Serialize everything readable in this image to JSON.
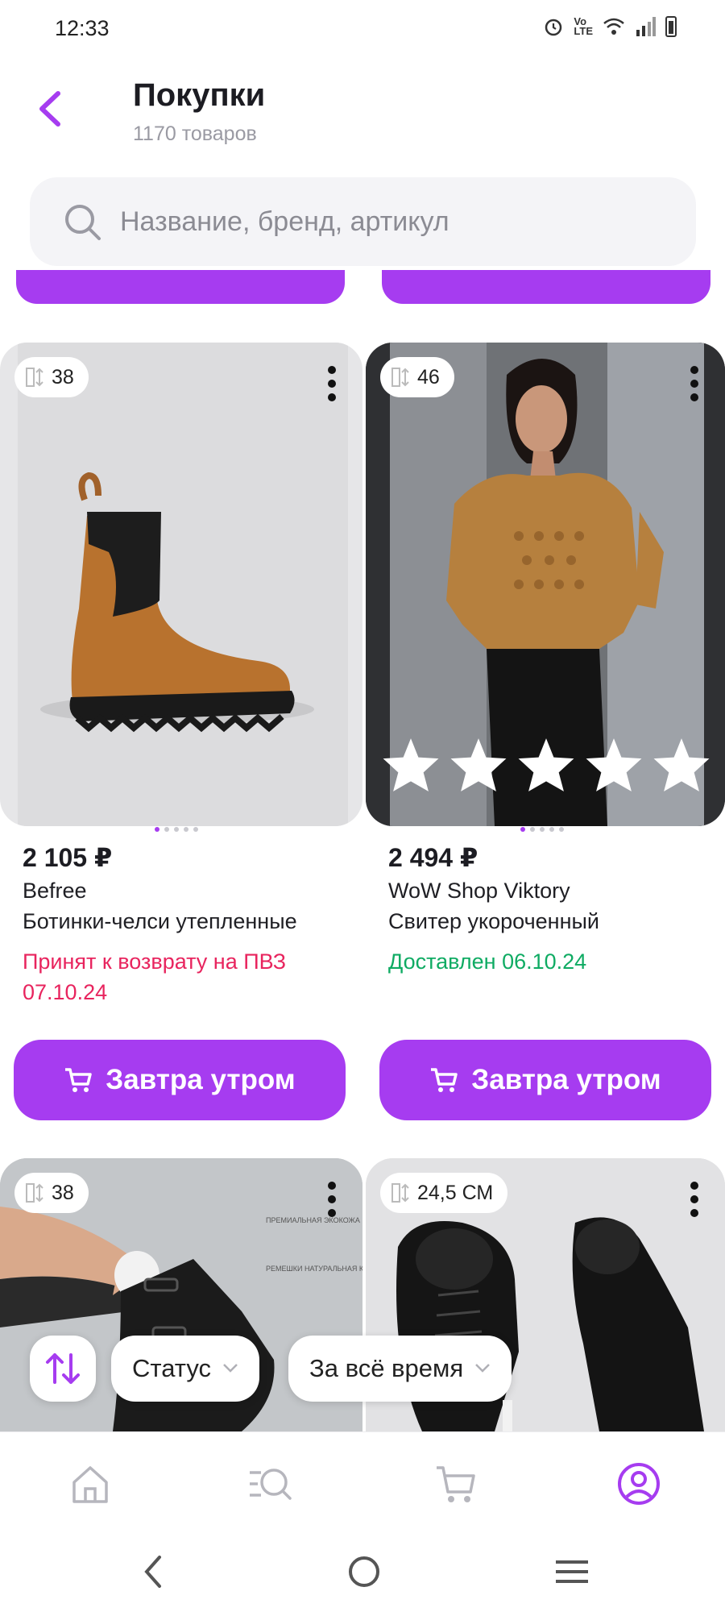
{
  "status_bar": {
    "time": "12:33",
    "icons": [
      "alarm-icon",
      "volte-icon",
      "wifi-icon",
      "signal-icon",
      "battery-icon"
    ]
  },
  "header": {
    "title": "Покупки",
    "subtitle": "1170 товаров"
  },
  "search": {
    "placeholder": "Название, бренд, артикул"
  },
  "products": [
    {
      "size": "38",
      "price": "2 105 ₽",
      "brand": "Befree",
      "name": "Ботинки-челси утепленные",
      "status_line1": "Принят к возврату на ПВЗ",
      "status_line2": "07.10.24",
      "status_color": "#e8245e",
      "button": "Завтра утром",
      "image": "brown chelsea boot"
    },
    {
      "size": "46",
      "price": "2 494 ₽",
      "brand": "WoW Shop Viktory",
      "name": "Свитер укороченный",
      "status": "Доставлен 06.10.24",
      "status_color": "#0fab63",
      "button": "Завтра утром",
      "image": "woman in camel crochet sweater",
      "rating_stars": 5
    },
    {
      "size": "38",
      "image": "black leather ankle boot on leg",
      "image_text_1": "ПРЕМИАЛЬНАЯ ЭКОКОЖА",
      "image_text_2": "РЕМЕШКИ НАТУРАЛЬНАЯ КОЖА"
    },
    {
      "size": "24,5 СМ",
      "image": "black chunky lace-up boots"
    }
  ],
  "filters": {
    "status": "Статус",
    "period": "За всё время"
  },
  "bottom_nav": [
    "home-icon",
    "catalog-search-icon",
    "cart-icon",
    "profile-icon"
  ],
  "colors": {
    "accent": "#a63cf0",
    "returned": "#e8245e",
    "delivered": "#0fab63"
  }
}
